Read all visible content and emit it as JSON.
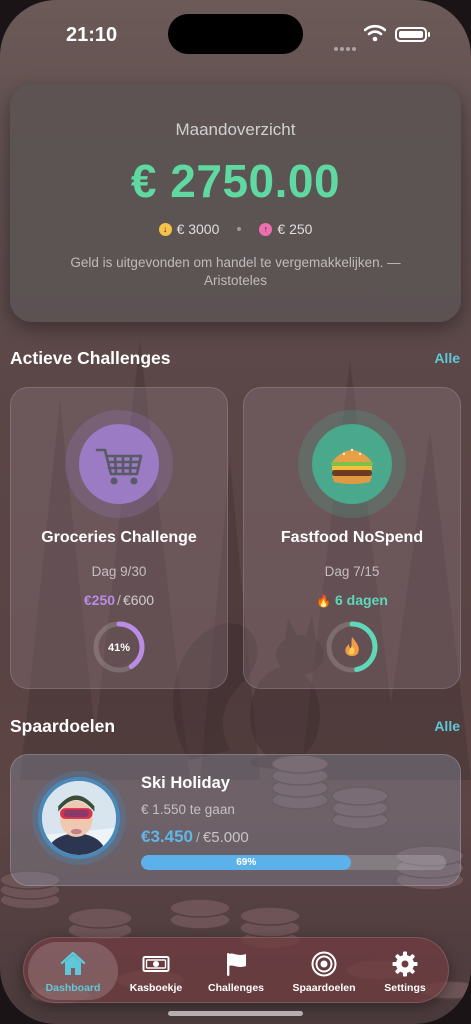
{
  "status_bar": {
    "time": "21:10"
  },
  "overview": {
    "title": "Maandoverzicht",
    "amount": "€ 2750.00",
    "income": "€ 3000",
    "expense": "€ 250",
    "quote": "Geld is uitgevonden om handel te vergemakkelijken. — Aristoteles"
  },
  "challenges": {
    "title": "Actieve Challenges",
    "see_all": "Alle",
    "items": [
      {
        "icon": "shopping-cart-icon",
        "name": "Groceries Challenge",
        "day": "Dag 9/30",
        "spent": "€250",
        "slash": "/",
        "budget": "€600",
        "ring_label": "41%",
        "progress": 0.41,
        "ring_color": "#b98ce6",
        "circle_color": "#9a7bc4"
      },
      {
        "icon": "burger-icon",
        "name": "Fastfood NoSpend",
        "day": "Dag 7/15",
        "streak_icon": "🔥",
        "streak": "6 dagen",
        "progress": 0.4667,
        "ring_color": "#5ed8b8",
        "circle_color": "#4aa88c"
      }
    ]
  },
  "savings": {
    "title": "Spaardoelen",
    "see_all": "Alle",
    "goal": {
      "name": "Ski Holiday",
      "remaining": "€ 1.550 te gaan",
      "saved": "€3.450",
      "slash": "/",
      "target": "€5.000",
      "percent_label": "69%",
      "progress": 0.69
    }
  },
  "tabs": [
    {
      "label": "Dashboard",
      "icon": "house-icon",
      "active": true
    },
    {
      "label": "Kasboekje",
      "icon": "banknote-icon",
      "active": false
    },
    {
      "label": "Challenges",
      "icon": "flag-icon",
      "active": false
    },
    {
      "label": "Spaardoelen",
      "icon": "target-icon",
      "active": false
    },
    {
      "label": "Settings",
      "icon": "gear-icon",
      "active": false
    }
  ],
  "colors": {
    "accent_green": "#5fd8a1",
    "accent_teal": "#5fc8d8",
    "accent_purple": "#b98ce6",
    "accent_blue": "#5fb6e8",
    "streak_orange": "#f29a4a"
  }
}
